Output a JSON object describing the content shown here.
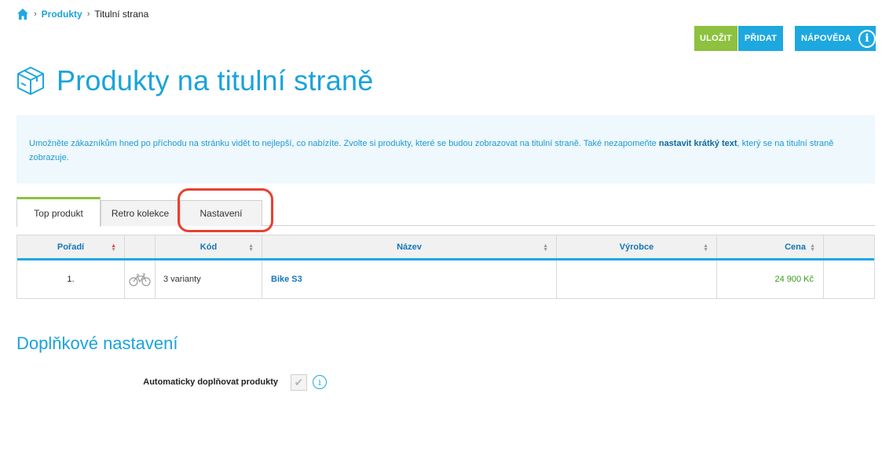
{
  "breadcrumb": {
    "home_icon": "home-icon",
    "link": "Produkty",
    "current": "Titulní strana"
  },
  "toolbar": {
    "save_label": "ULOŽIT",
    "add_label": "PŘIDAT",
    "help_label": "NÁPOVĚDA",
    "help_icon": "info-icon"
  },
  "page": {
    "title": "Produkty na titulní straně",
    "title_icon": "box-icon"
  },
  "info": {
    "text_before": "Umožněte zákazníkům hned po příchodu na stránku vidět to nejlepší, co nabízíte. Zvolte si produkty, které se budou zobrazovat na titulní straně. Také nezapomeňte ",
    "link_text": "nastavit krátký text",
    "text_after": ", který se na titulní straně zobrazuje."
  },
  "tabs": [
    {
      "label": "Top produkt",
      "active": true
    },
    {
      "label": "Retro kolekce",
      "active": false
    },
    {
      "label": "Nastavení",
      "active": false
    }
  ],
  "table": {
    "columns": [
      "Pořadí",
      "",
      "Kód",
      "Název",
      "Výrobce",
      "Cena",
      ""
    ],
    "rows": [
      {
        "order": "1.",
        "image_icon": "bicycle-icon",
        "code": "3 varianty",
        "name": "Bike S3",
        "manufacturer": "",
        "price": "24 900 Kč"
      }
    ]
  },
  "additional": {
    "title": "Doplňkové nastavení",
    "setting_label": "Automaticky doplňovat produkty",
    "checked": true
  },
  "colors": {
    "accent": "#1ea8e0",
    "save": "#8dc13f",
    "highlight": "#e8402f",
    "price": "#3a9a1e"
  }
}
